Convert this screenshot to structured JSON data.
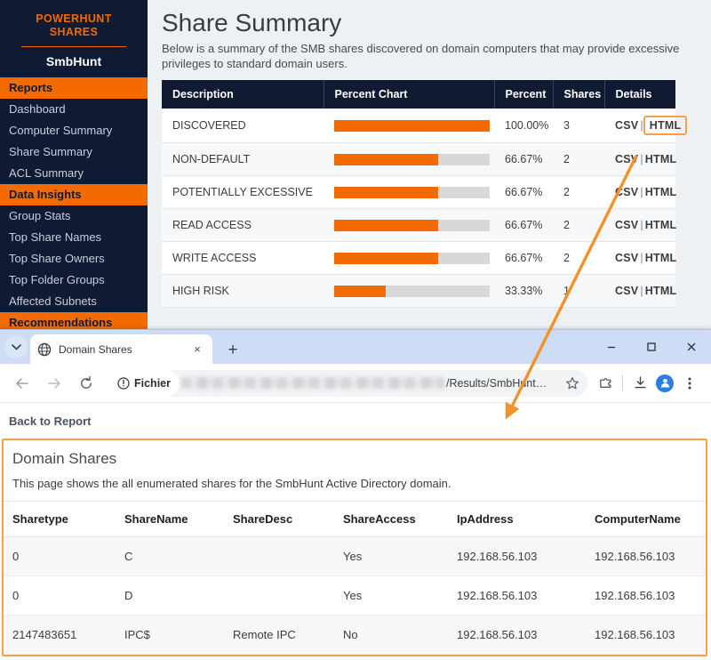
{
  "app": {
    "brand": {
      "line1": "POWERHUNT",
      "line2": "SHARES",
      "subtitle": "SmbHunt"
    },
    "sidebar": {
      "sections": [
        {
          "header": "Reports",
          "items": [
            "Dashboard",
            "Computer Summary",
            "Share Summary",
            "ACL Summary"
          ]
        },
        {
          "header": "Data Insights",
          "items": [
            "Group Stats",
            "Top Share Names",
            "Top Share Owners",
            "Top Folder Groups",
            "Affected Subnets"
          ]
        },
        {
          "header": "Recommendations",
          "items": []
        }
      ]
    },
    "page": {
      "title": "Share Summary",
      "description": "Below is a summary of the SMB shares discovered on domain computers that may provide excessive privileges to standard domain users."
    },
    "summary_table": {
      "headers": [
        "Description",
        "Percent Chart",
        "Percent",
        "Shares",
        "Details"
      ],
      "rows": [
        {
          "description": "DISCOVERED",
          "percent_value": 100.0,
          "percent": "100.00%",
          "shares": "3",
          "csv": "CSV",
          "html": "HTML",
          "highlight": true
        },
        {
          "description": "NON-DEFAULT",
          "percent_value": 66.67,
          "percent": "66.67%",
          "shares": "2",
          "csv": "CSV",
          "html": "HTML",
          "highlight": false
        },
        {
          "description": "POTENTIALLY EXCESSIVE",
          "percent_value": 66.67,
          "percent": "66.67%",
          "shares": "2",
          "csv": "CSV",
          "html": "HTML",
          "highlight": false
        },
        {
          "description": "READ ACCESS",
          "percent_value": 66.67,
          "percent": "66.67%",
          "shares": "2",
          "csv": "CSV",
          "html": "HTML",
          "highlight": false
        },
        {
          "description": "WRITE ACCESS",
          "percent_value": 66.67,
          "percent": "66.67%",
          "shares": "2",
          "csv": "CSV",
          "html": "HTML",
          "highlight": false
        },
        {
          "description": "HIGH RISK",
          "percent_value": 33.33,
          "percent": "33.33%",
          "shares": "1",
          "csv": "CSV",
          "html": "HTML",
          "highlight": false
        }
      ],
      "separator": "|"
    }
  },
  "browser": {
    "tab": {
      "title": "Domain Shares",
      "favicon": "globe-icon",
      "close": "×"
    },
    "new_tab": "+",
    "window_controls": {
      "minimize": "−",
      "maximize": "□",
      "close": "✕"
    },
    "omnibox": {
      "scheme_label": "Fichier",
      "url_suffix": "/Results/SmbHunt…"
    }
  },
  "report_page": {
    "back_link": "Back to Report",
    "title": "Domain Shares",
    "description": "This page shows the all enumerated shares for the SmbHunt Active Directory domain.",
    "table": {
      "headers": [
        "Sharetype",
        "ShareName",
        "ShareDesc",
        "ShareAccess",
        "IpAddress",
        "ComputerName"
      ],
      "rows": [
        [
          "0",
          "C",
          "",
          "Yes",
          "192.168.56.103",
          "192.168.56.103"
        ],
        [
          "0",
          "D",
          "",
          "Yes",
          "192.168.56.103",
          "192.168.56.103"
        ],
        [
          "2147483651",
          "IPC$",
          "Remote IPC",
          "No",
          "192.168.56.103",
          "192.168.56.103"
        ]
      ]
    }
  },
  "colors": {
    "brand_orange": "#f26a00",
    "navy": "#101a33",
    "bar_track": "#d8d8d8",
    "annotation": "#f2922d",
    "highlight_border": "#f5a04a"
  }
}
